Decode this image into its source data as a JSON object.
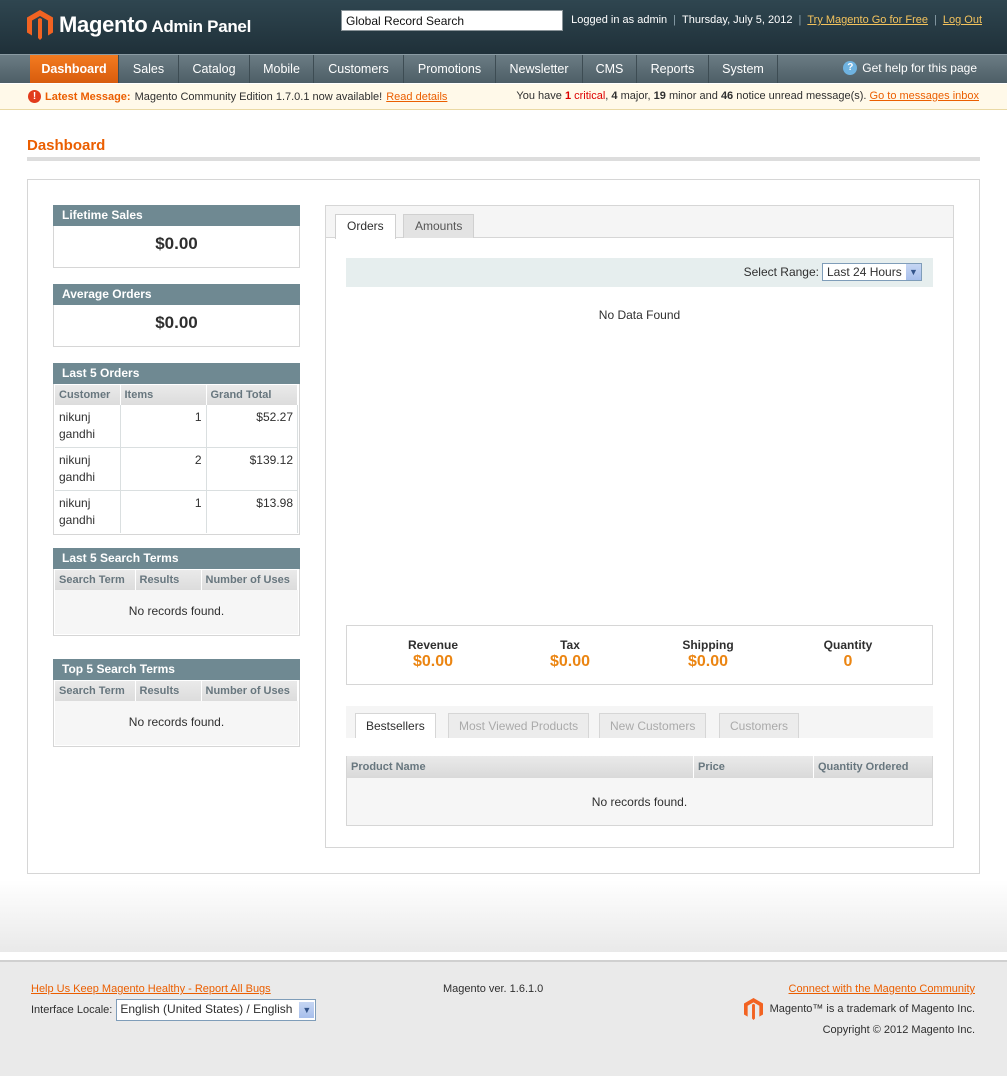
{
  "header": {
    "logo_main": "Magento",
    "logo_sub": "Admin Panel",
    "search_value": "Global Record Search",
    "logged_in": "Logged in as admin",
    "date": "Thursday, July 5, 2012",
    "try_link": "Try Magento Go for Free",
    "logout": "Log Out"
  },
  "nav": {
    "items": [
      "Dashboard",
      "Sales",
      "Catalog",
      "Mobile",
      "Customers",
      "Promotions",
      "Newsletter",
      "CMS",
      "Reports",
      "System"
    ],
    "help": "Get help for this page"
  },
  "message": {
    "label": "Latest Message:",
    "text": "Magento Community Edition 1.7.0.1 now available!",
    "link": "Read details",
    "summary_prefix": "You have",
    "critical_count": "1",
    "critical_label": "critical",
    "major_count": "4",
    "major_label": "major,",
    "minor_count": "19",
    "minor_label": "minor and",
    "notice_count": "46",
    "notice_label": "notice unread message(s).",
    "inbox_link": "Go to messages inbox"
  },
  "page": {
    "title": "Dashboard"
  },
  "lifetime_sales": {
    "title": "Lifetime Sales",
    "value": "$0.00"
  },
  "average_orders": {
    "title": "Average Orders",
    "value": "$0.00"
  },
  "last_orders": {
    "title": "Last 5 Orders",
    "columns": [
      "Customer",
      "Items",
      "Grand Total"
    ],
    "rows": [
      {
        "customer": "nikunj gandhi",
        "items": "1",
        "total": "$52.27"
      },
      {
        "customer": "nikunj gandhi",
        "items": "2",
        "total": "$139.12"
      },
      {
        "customer": "nikunj gandhi",
        "items": "1",
        "total": "$13.98"
      }
    ]
  },
  "last_search": {
    "title": "Last 5 Search Terms",
    "columns": [
      "Search Term",
      "Results",
      "Number of Uses"
    ],
    "empty": "No records found."
  },
  "top_search": {
    "title": "Top 5 Search Terms",
    "columns": [
      "Search Term",
      "Results",
      "Number of Uses"
    ],
    "empty": "No records found."
  },
  "chart": {
    "tabs": [
      "Orders",
      "Amounts"
    ],
    "range_label": "Select Range:",
    "range_value": "Last 24 Hours",
    "nodata": "No Data Found"
  },
  "totals": [
    {
      "label": "Revenue",
      "value": "$0.00"
    },
    {
      "label": "Tax",
      "value": "$0.00"
    },
    {
      "label": "Shipping",
      "value": "$0.00"
    },
    {
      "label": "Quantity",
      "value": "0"
    }
  ],
  "bottom_tabs": [
    "Bestsellers",
    "Most Viewed Products",
    "New Customers",
    "Customers"
  ],
  "bestsellers": {
    "columns": [
      "Product Name",
      "Price",
      "Quantity Ordered"
    ],
    "empty": "No records found."
  },
  "footer": {
    "bug_link": "Help Us Keep Magento Healthy - Report All Bugs",
    "locale_label": "Interface Locale:",
    "locale_value": "English (United States) / English",
    "version": "Magento ver. 1.6.1.0",
    "community_link": "Connect with the Magento Community",
    "trademark": "Magento™ is a trademark of Magento Inc.",
    "copyright": "Copyright © 2012 Magento Inc."
  },
  "colors": {
    "accent": "#eb5e00",
    "header": "#2a3e48",
    "nav": "#5d6e76",
    "box_head": "#6f8992"
  }
}
